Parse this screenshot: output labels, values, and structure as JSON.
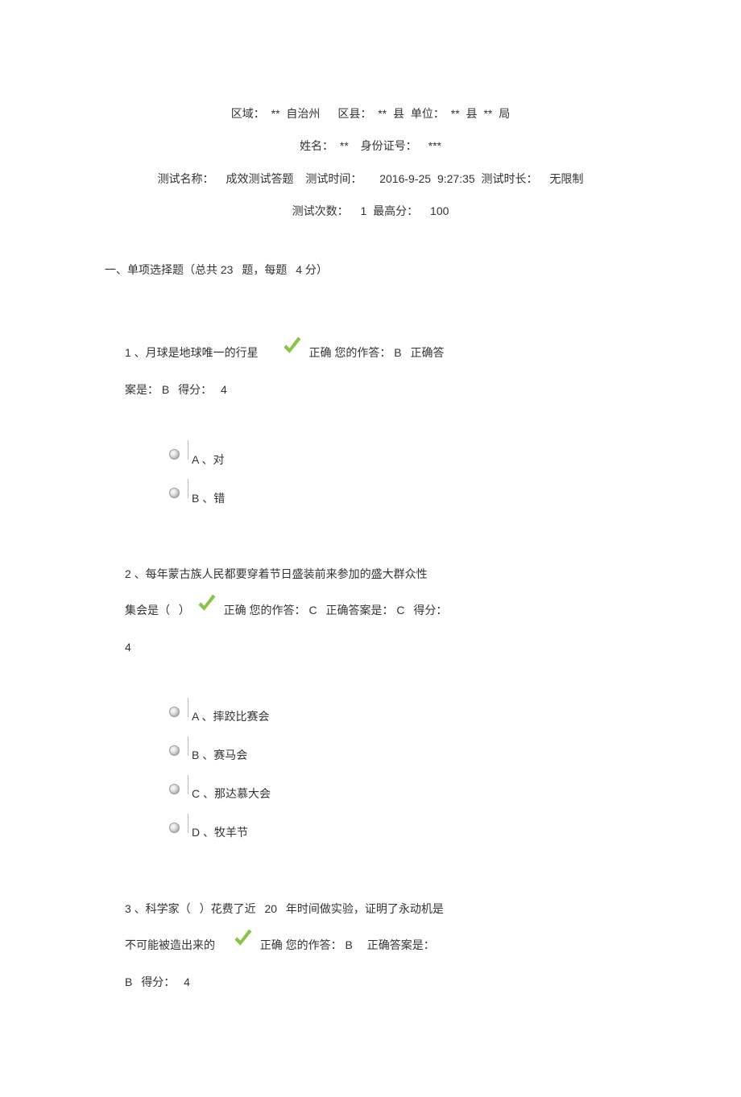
{
  "header": {
    "line1": "区域： ** 自治州  区县： ** 县 单位： ** 县 ** 局",
    "line2": "姓名： **  身份证号： ***",
    "line3": "测试名称：  成效测试答题  测试时间：  2016-9-25 9:27:35 测试时长：  无限制",
    "line4": "测试次数：  1 最高分：  100"
  },
  "section": {
    "title": "一、单项选择题（总共  23  题，每题  4 分）"
  },
  "q1": {
    "pre": "1 、月球是地球唯一的行星  ",
    "after_icon": "正确 您的作答：  B  正确答",
    "line2": "案是： B  得分：  4",
    "optA": "A 、对",
    "optB": "B 、错"
  },
  "q2": {
    "line1": "2 、每年蒙古族人民都要穿着节日盛装前来参加的盛大群众性",
    "line2pre": "集会是（  ）",
    "line2after": "正确 您的作答：  C  正确答案是：  C  得分：",
    "line3": "4",
    "optA": "A 、摔跤比赛会",
    "optB": "B 、赛马会",
    "optC": "C 、那达慕大会",
    "optD": "D 、牧羊节"
  },
  "q3": {
    "line1": "3 、科学家（  ）花费了近   20  年时间做实验，证明了永动机是",
    "line2pre": "不可能被造出来的 ",
    "line2after": "正确 您的作答： B  正确答案是：",
    "line3": "B  得分：  4"
  }
}
